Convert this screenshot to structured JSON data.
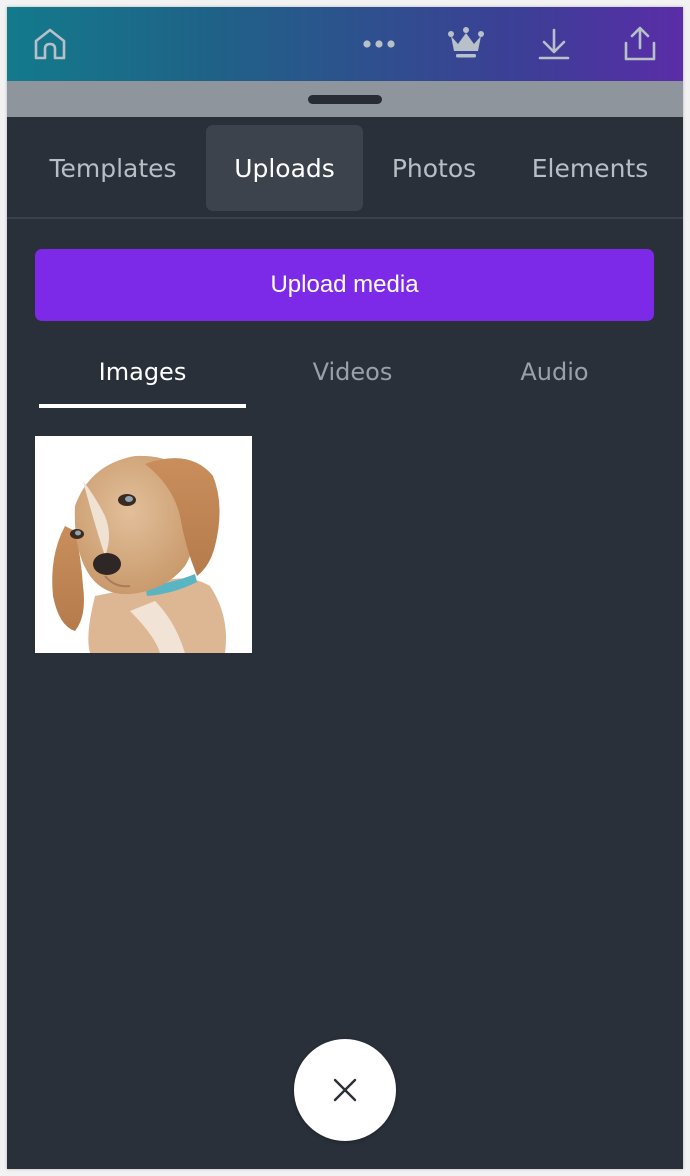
{
  "topbar": {
    "icons": {
      "home": "home-icon",
      "more": "more-horizontal-icon",
      "premium": "crown-icon",
      "download": "download-icon",
      "share": "share-icon"
    }
  },
  "tabs": [
    {
      "label": "Templates",
      "active": false
    },
    {
      "label": "Uploads",
      "active": true
    },
    {
      "label": "Photos",
      "active": false
    },
    {
      "label": "Elements",
      "active": false
    }
  ],
  "upload_button": {
    "label": "Upload media"
  },
  "media_tabs": [
    {
      "label": "Images",
      "active": true
    },
    {
      "label": "Videos",
      "active": false
    },
    {
      "label": "Audio",
      "active": false
    }
  ],
  "uploads": [
    {
      "description": "beagle puppy photo"
    }
  ],
  "close_button": {
    "icon": "close-icon"
  },
  "colors": {
    "accent": "#7d2ae8",
    "panel_bg": "#2a303a",
    "active_tab_bg": "#3c434d",
    "header_gradient_start": "#137a8c",
    "header_gradient_end": "#5a2da8"
  }
}
